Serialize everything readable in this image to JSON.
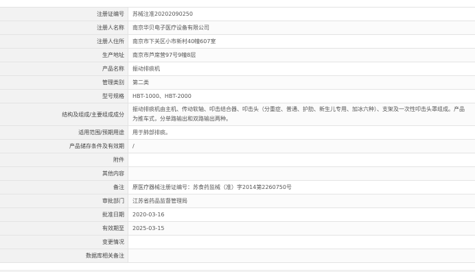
{
  "rows": [
    {
      "label": "注册证编号",
      "value": "苏械注准20202090250"
    },
    {
      "label": "注册人名称",
      "value": "南京华贝电子医疗设备有限公司"
    },
    {
      "label": "注册人住所",
      "value": "南京市下关区小市新村40幢607室"
    },
    {
      "label": "生产地址",
      "value": "南京市芦席营97号9幢8层"
    },
    {
      "label": "产品名称",
      "value": "振动排痰机"
    },
    {
      "label": "管理类别",
      "value": "第二类"
    },
    {
      "label": "型号规格",
      "value": "HBT-1000、HBT-2000"
    },
    {
      "label": "结构及组成/主要组成成分",
      "value": "振动排痰机由主机、传动软轴、叩击结合器、叩击头（分重症、普通、护肋、新生儿专用、加冰六种）、支架及一次性叩击头罩组成。产品为推车式，分单路输出和双路输出两种。"
    },
    {
      "label": "适用范围/预期用途",
      "value": "用于肺部排痰。"
    },
    {
      "label": "产品储存条件及有效期",
      "value": "/"
    },
    {
      "label": "附件",
      "value": ""
    },
    {
      "label": "其他内容",
      "value": ""
    },
    {
      "label": "备注",
      "value": "原医疗器械注册证编号：苏食药监械（准）字2014第2260750号"
    },
    {
      "label": "审批部门",
      "value": "江苏省药品监督管理局"
    },
    {
      "label": "批准日期",
      "value": "2020-03-16"
    },
    {
      "label": "有效期至",
      "value": "2025-03-15"
    },
    {
      "label": "变更情况",
      "value": ""
    },
    {
      "label": "数据库相关备注",
      "value": ""
    }
  ]
}
